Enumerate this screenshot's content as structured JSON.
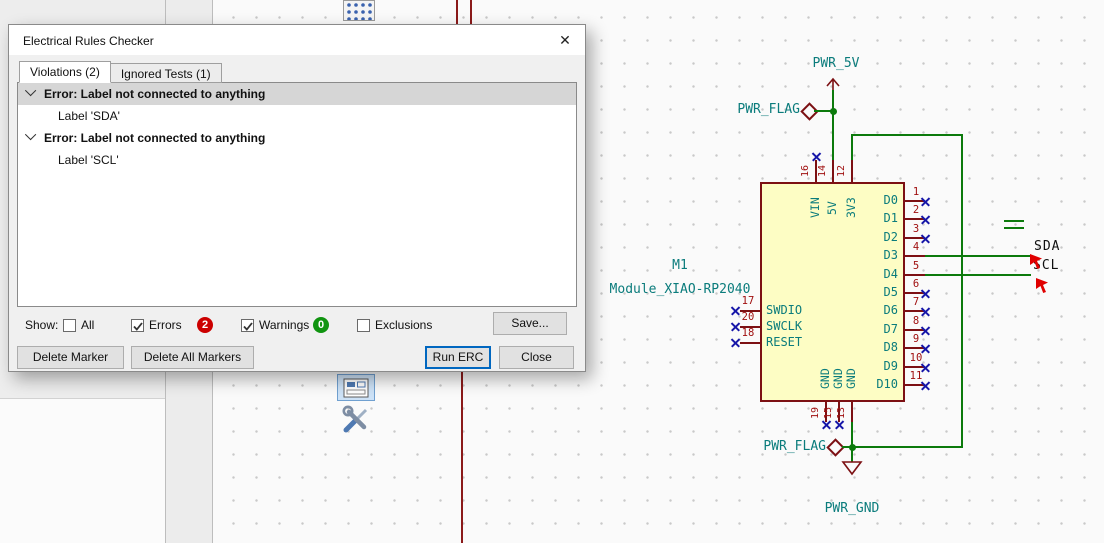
{
  "dialog": {
    "title": "Electrical Rules Checker",
    "close_glyph": "✕",
    "tabs": [
      {
        "label": "Violations (2)"
      },
      {
        "label": "Ignored Tests (1)"
      }
    ],
    "violations": [
      {
        "header": "Error: Label not connected to anything",
        "detail": "Label 'SDA'",
        "selected": true
      },
      {
        "header": "Error: Label not connected to anything",
        "detail": "Label 'SCL'",
        "selected": false
      }
    ],
    "show_label": "Show:",
    "filters": [
      {
        "label": "All",
        "checked": false
      },
      {
        "label": "Errors",
        "checked": true,
        "badge": "2",
        "badge_color": "#cc0000"
      },
      {
        "label": "Warnings",
        "checked": true,
        "badge": "0",
        "badge_color": "#109410"
      },
      {
        "label": "Exclusions",
        "checked": false
      }
    ],
    "buttons": {
      "save": "Save...",
      "delete_marker": "Delete Marker",
      "delete_all_markers": "Delete All Markers",
      "run_erc": "Run ERC",
      "close": "Close"
    }
  },
  "schematic": {
    "component": {
      "reference": "M1",
      "value": "Module_XIAO-RP2040"
    },
    "power": {
      "pwr_5v": "PWR_5V",
      "pwr_flag_top": "PWR_FLAG",
      "pwr_flag_bottom": "PWR_FLAG",
      "pwr_gnd": "PWR_GND"
    },
    "net_labels": {
      "sda": "SDA",
      "scl": "SCL"
    },
    "pins_right": [
      {
        "name": "D0",
        "num": "1"
      },
      {
        "name": "D1",
        "num": "2"
      },
      {
        "name": "D2",
        "num": "3"
      },
      {
        "name": "D3",
        "num": "4"
      },
      {
        "name": "D4",
        "num": "5"
      },
      {
        "name": "D5",
        "num": "6"
      },
      {
        "name": "D6",
        "num": "7"
      },
      {
        "name": "D7",
        "num": "8"
      },
      {
        "name": "D8",
        "num": "9"
      },
      {
        "name": "D9",
        "num": "10"
      },
      {
        "name": "D10",
        "num": "11"
      }
    ],
    "pins_left": [
      {
        "name": "SWDIO",
        "num": "17"
      },
      {
        "name": "SWCLK",
        "num": "20"
      },
      {
        "name": "RESET",
        "num": "18"
      }
    ],
    "pins_top": [
      {
        "name": "VIN",
        "num": "16"
      },
      {
        "name": "5V",
        "num": "14"
      },
      {
        "name": "3V3",
        "num": "12"
      }
    ],
    "pins_bottom": [
      {
        "name": "GND",
        "num": "19"
      },
      {
        "name": "GND",
        "num": "15"
      },
      {
        "name": "GND",
        "num": "13"
      }
    ],
    "colors": {
      "wire": "#0c7a0c",
      "symbol_outline": "#7c1013",
      "pin_name": "#0b7c7c",
      "pin_number": "#a01010",
      "no_connect": "#1616a8",
      "net_label": "#101010",
      "body_fill": "#fdfdc4",
      "erc_marker": "#e00000"
    }
  }
}
